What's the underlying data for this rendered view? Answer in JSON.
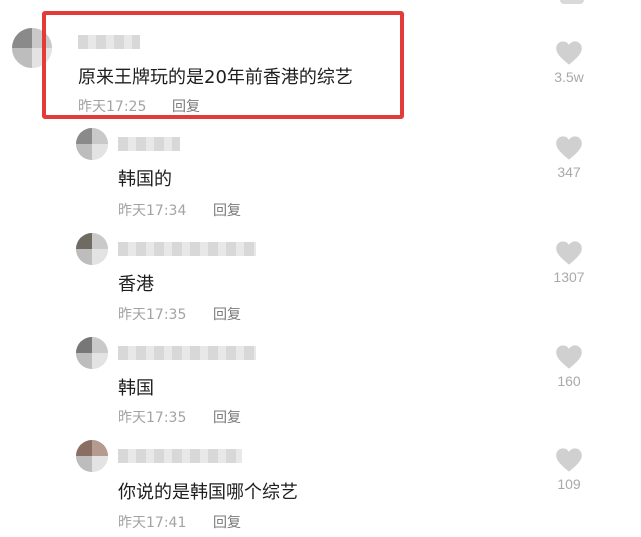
{
  "comments": [
    {
      "level": "top",
      "text": "原来王牌玩的是20年前香港的综艺",
      "time": "昨天17:25",
      "reply_label": "回复",
      "likes": "3.5w"
    },
    {
      "level": "reply",
      "text": "韩国的",
      "time": "昨天17:34",
      "reply_label": "回复",
      "likes": "347"
    },
    {
      "level": "reply",
      "text": "香港",
      "time": "昨天17:35",
      "reply_label": "回复",
      "likes": "1307"
    },
    {
      "level": "reply",
      "text": "韩国",
      "time": "昨天17:35",
      "reply_label": "回复",
      "likes": "160"
    },
    {
      "level": "reply",
      "text": "你说的是韩国哪个综艺",
      "time": "昨天17:41",
      "reply_label": "回复",
      "likes": "109"
    }
  ],
  "icons": {
    "like": "heart-icon",
    "avatar": "blurred-avatar"
  },
  "colors": {
    "highlight_border": "#e33a3a",
    "like_icon": "#d0d0d0",
    "meta_text": "#a3a3a3"
  }
}
